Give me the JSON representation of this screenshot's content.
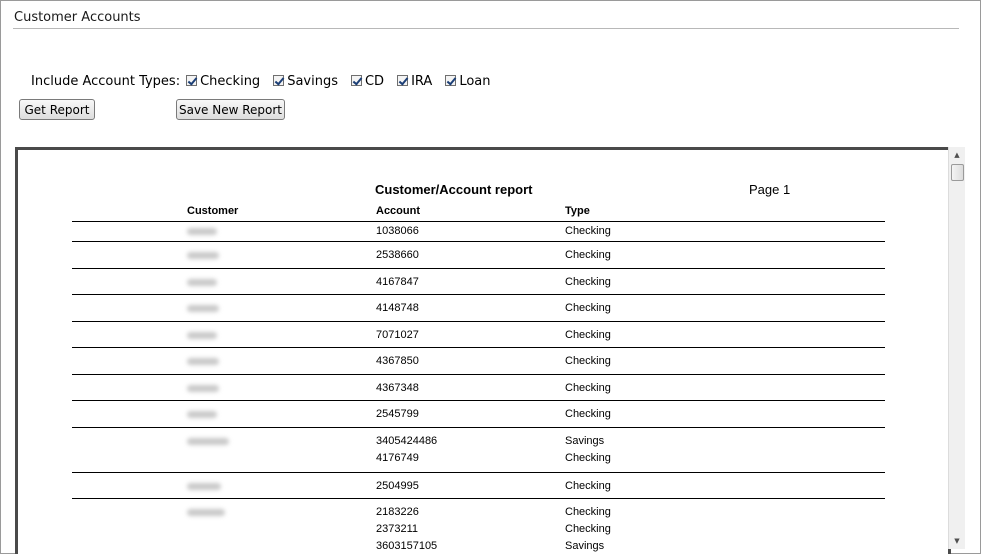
{
  "window": {
    "title": "Customer Accounts"
  },
  "filters": {
    "label": "Include Account Types:",
    "options": [
      {
        "label": "Checking",
        "checked": true
      },
      {
        "label": "Savings",
        "checked": true
      },
      {
        "label": "CD",
        "checked": true
      },
      {
        "label": "IRA",
        "checked": true
      },
      {
        "label": "Loan",
        "checked": true
      }
    ]
  },
  "buttons": {
    "get_report": "Get Report",
    "save_new_report": "Save New Report"
  },
  "report": {
    "title": "Customer/Account report",
    "page_label": "Page",
    "page_number": "1",
    "columns": {
      "customer": "Customer",
      "account": "Account",
      "type": "Type"
    },
    "groups": [
      {
        "accounts": [
          {
            "account": "1038066",
            "type": "Checking"
          }
        ]
      },
      {
        "accounts": [
          {
            "account": "2538660",
            "type": "Checking"
          }
        ]
      },
      {
        "accounts": [
          {
            "account": "4167847",
            "type": "Checking"
          }
        ]
      },
      {
        "accounts": [
          {
            "account": "4148748",
            "type": "Checking"
          }
        ]
      },
      {
        "accounts": [
          {
            "account": "7071027",
            "type": "Checking"
          }
        ]
      },
      {
        "accounts": [
          {
            "account": "4367850",
            "type": "Checking"
          }
        ]
      },
      {
        "accounts": [
          {
            "account": "4367348",
            "type": "Checking"
          }
        ]
      },
      {
        "accounts": [
          {
            "account": "2545799",
            "type": "Checking"
          }
        ]
      },
      {
        "accounts": [
          {
            "account": "3405424486",
            "type": "Savings"
          },
          {
            "account": "4176749",
            "type": "Checking"
          }
        ]
      },
      {
        "accounts": [
          {
            "account": "2504995",
            "type": "Checking"
          }
        ]
      },
      {
        "accounts": [
          {
            "account": "2183226",
            "type": "Checking"
          },
          {
            "account": "2373211",
            "type": "Checking"
          },
          {
            "account": "3603157105",
            "type": "Savings"
          }
        ]
      }
    ]
  },
  "colors": {
    "frame_border": "#4a4a4a",
    "checkmark": "#1c3f76",
    "blurred_name": "#c9c9c9"
  }
}
